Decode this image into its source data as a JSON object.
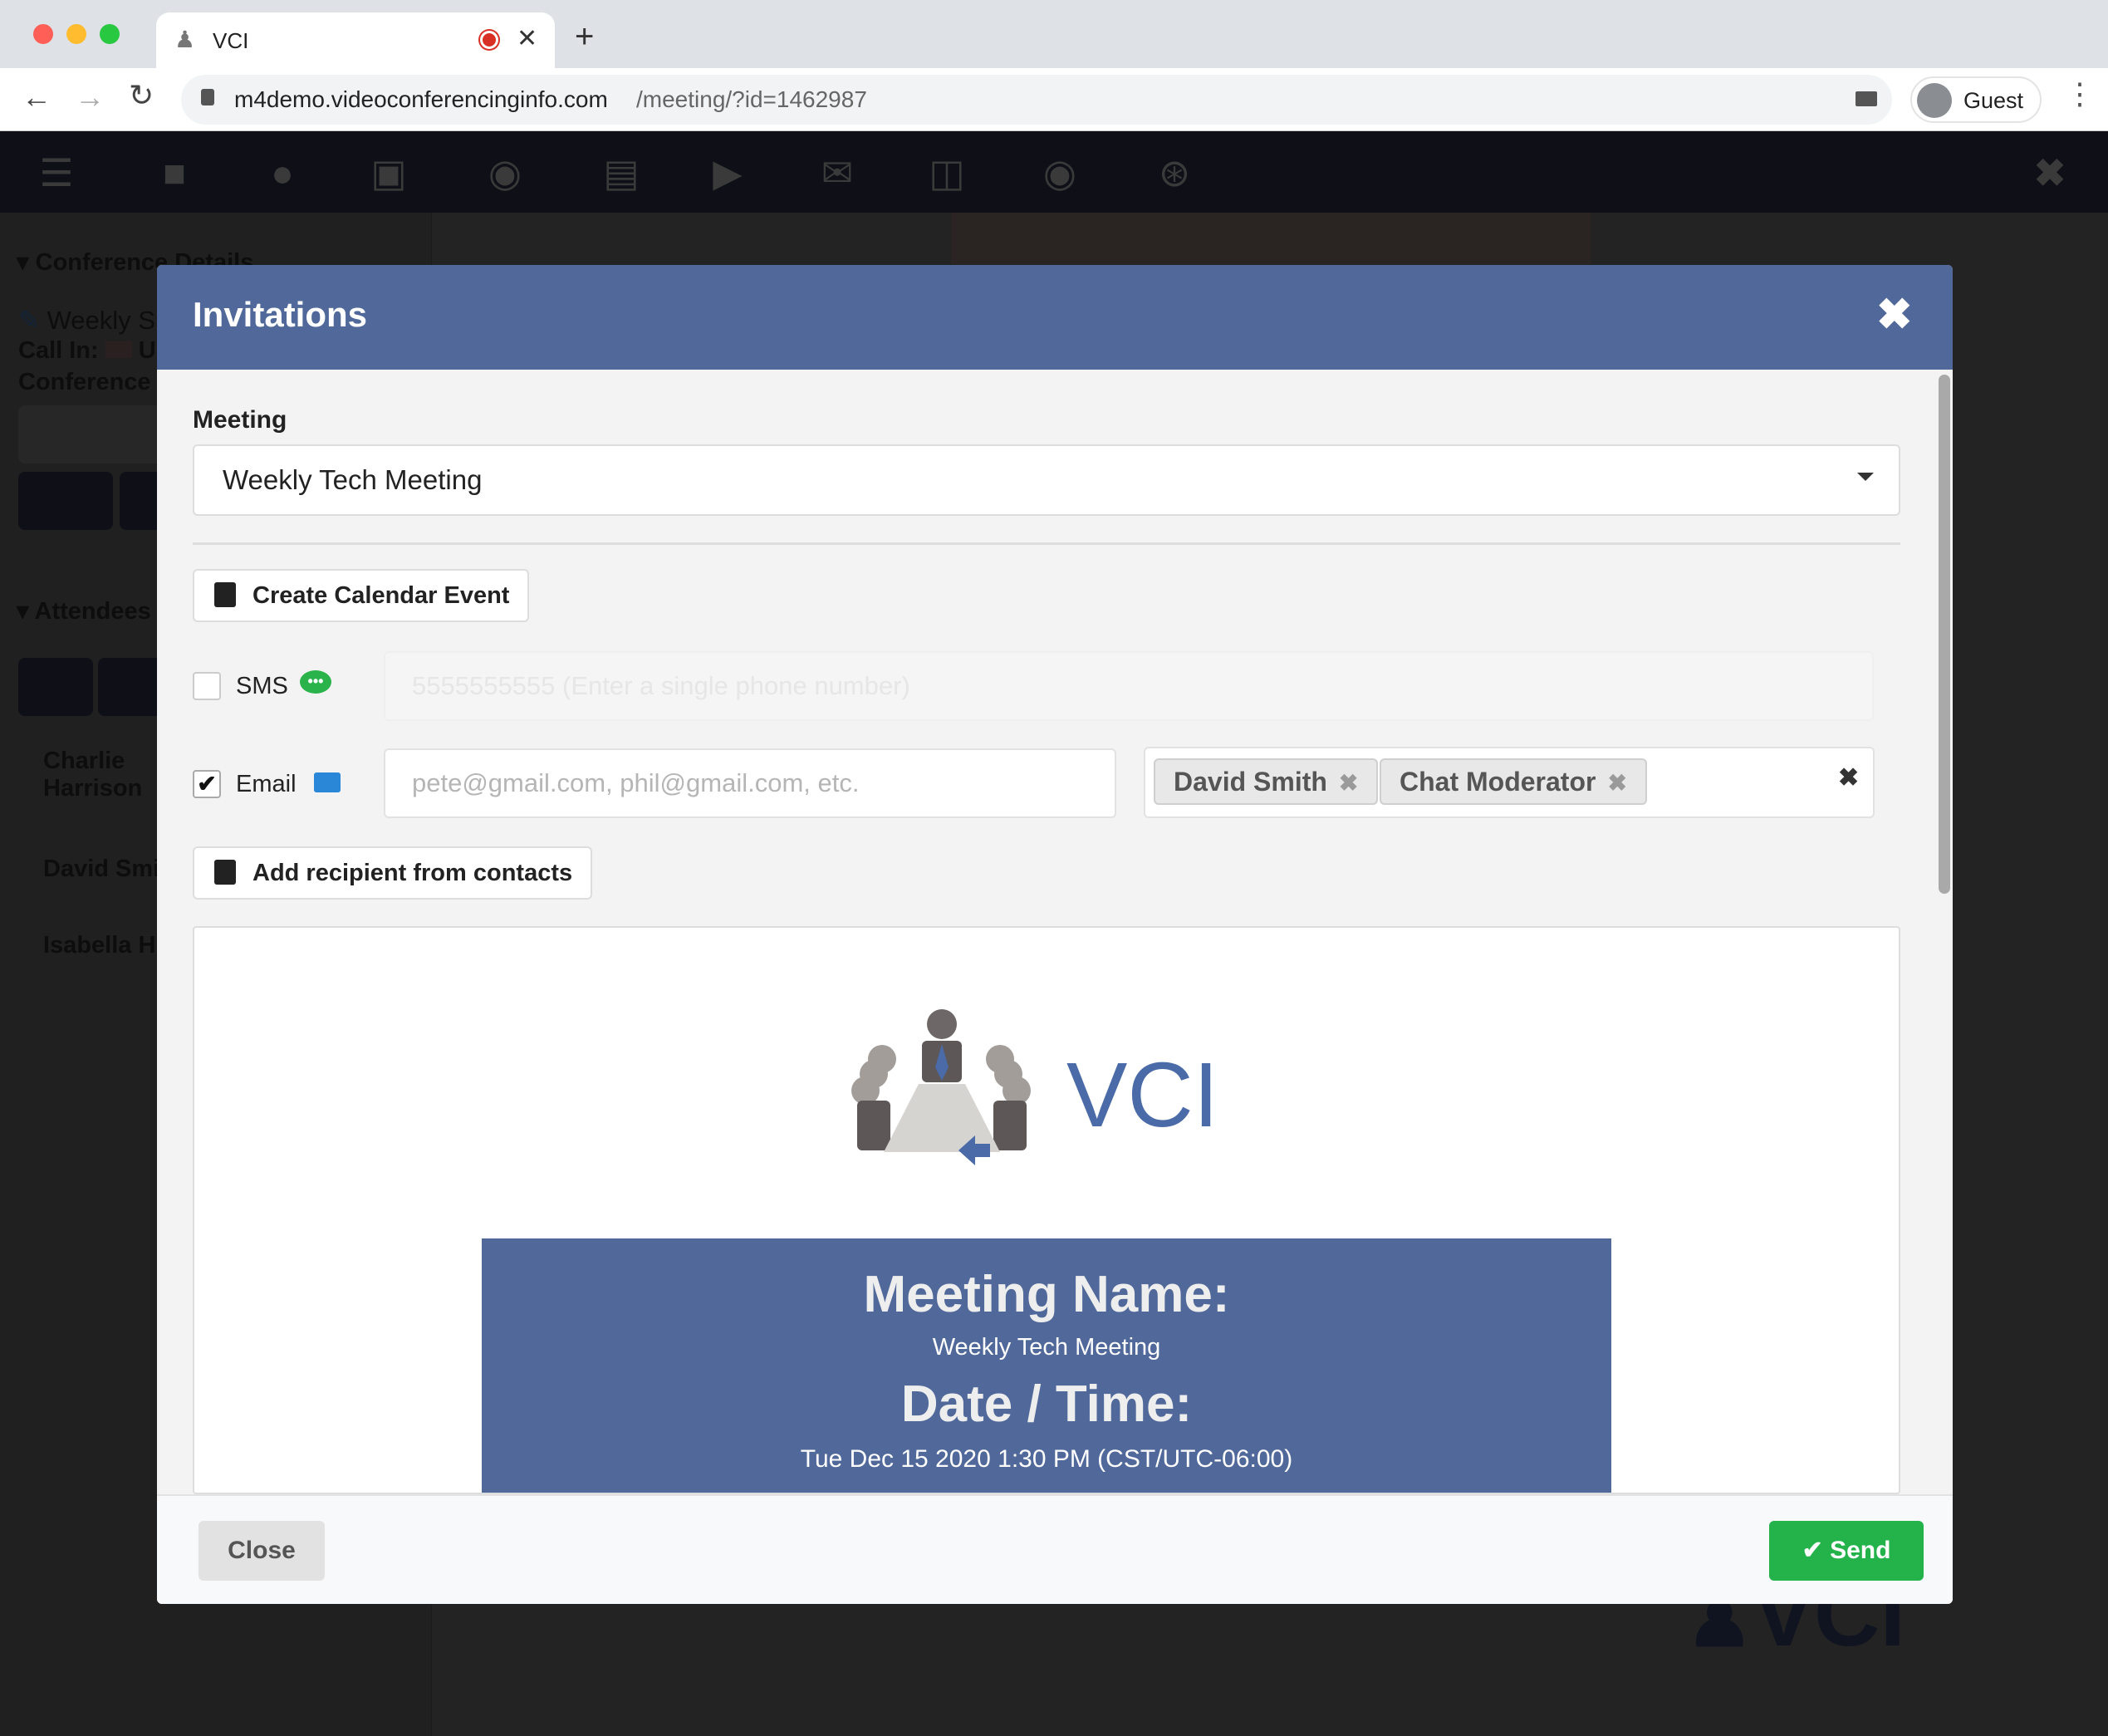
{
  "browser": {
    "tab_title": "VCI",
    "url_host": "m4demo.videoconferencinginfo.com",
    "url_path": "/meeting/?id=1462987",
    "profile_label": "Guest",
    "colors": {
      "close": "#ff5f57",
      "minimize": "#febc2e",
      "maximize": "#28c840",
      "recording": "#d93025"
    }
  },
  "app_toolbar": {
    "icons": [
      "menu-icon",
      "video-camera-icon",
      "microphone-icon",
      "screen-share-icon",
      "chat-icon",
      "document-icon",
      "media-player-icon",
      "envelope-icon",
      "exit-door-icon",
      "record-icon",
      "broadcast-icon"
    ],
    "close_icon": "close-icon"
  },
  "sidebar": {
    "conference_details_header": "Conference Details",
    "meeting_name_partial": "Weekly S",
    "call_in_label": "Call In:",
    "call_in_value_partial": "US",
    "conference_id_partial": "Conference II",
    "attendees_header": "Attendees",
    "attendees": [
      "Charlie Harrison",
      "David Smith",
      "Isabella H"
    ]
  },
  "modal": {
    "title": "Invitations",
    "meeting_label": "Meeting",
    "meeting_selected": "Weekly Tech Meeting",
    "create_calendar_label": "Create Calendar Event",
    "sms": {
      "label": "SMS",
      "checked": false,
      "placeholder": "5555555555 (Enter a single phone number)"
    },
    "email": {
      "label": "Email",
      "checked": true,
      "placeholder": "pete@gmail.com, phil@gmail.com, etc."
    },
    "recipients": [
      "David Smith",
      "Chat Moderator"
    ],
    "add_from_contacts_label": "Add recipient from contacts",
    "preview": {
      "logo_text": "VCI",
      "meeting_name_heading": "Meeting Name:",
      "meeting_name_value": "Weekly Tech Meeting",
      "datetime_heading": "Date / Time:",
      "datetime_value": "Tue Dec 15 2020 1:30 PM (CST/UTC-06:00)"
    },
    "close_label": "Close",
    "send_label": "Send",
    "colors": {
      "header": "#50689a",
      "send": "#24b24b",
      "sms_icon": "#2ab24b",
      "email_icon": "#2a86d6"
    }
  },
  "background_logo_text": "VCI"
}
